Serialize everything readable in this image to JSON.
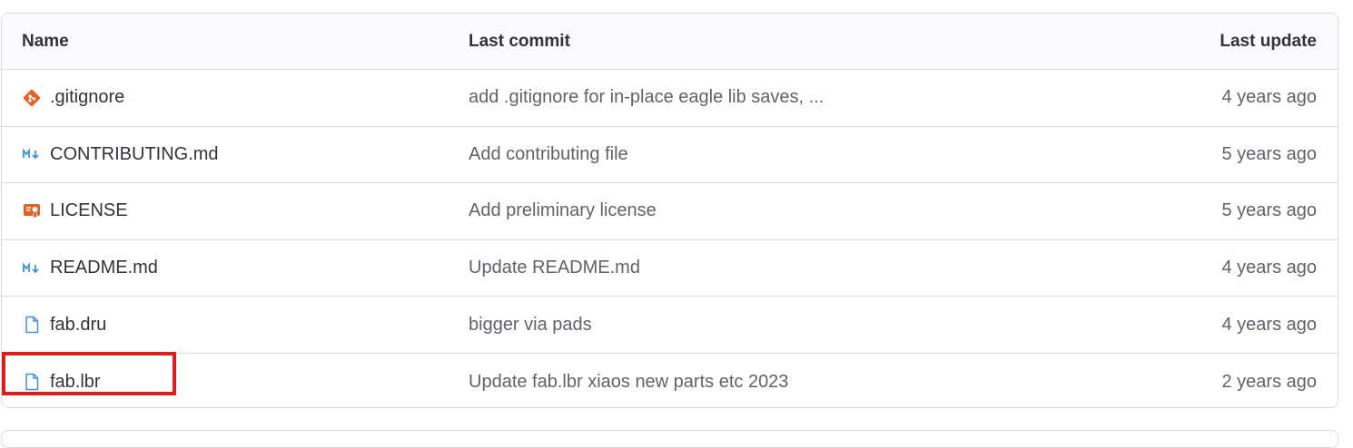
{
  "table": {
    "headers": {
      "name": "Name",
      "commit": "Last commit",
      "update": "Last update"
    },
    "rows": [
      {
        "name": ".gitignore",
        "icon": "git-icon",
        "commit": "add .gitignore for in-place eagle lib saves, ...",
        "date": "4 years ago"
      },
      {
        "name": "CONTRIBUTING.md",
        "icon": "markdown-icon",
        "commit": "Add contributing file",
        "date": "5 years ago"
      },
      {
        "name": "LICENSE",
        "icon": "license-icon",
        "commit": "Add preliminary license",
        "date": "5 years ago"
      },
      {
        "name": "README.md",
        "icon": "markdown-icon",
        "commit": "Update README.md",
        "date": "4 years ago"
      },
      {
        "name": "fab.dru",
        "icon": "file-icon",
        "commit": "bigger via pads",
        "date": "4 years ago"
      },
      {
        "name": "fab.lbr",
        "icon": "file-icon",
        "commit": "Update fab.lbr xiaos new parts etc 2023",
        "date": "2 years ago"
      }
    ]
  },
  "colors": {
    "git": "#e24329",
    "markdown": "#428fdc",
    "license": "#e2632a",
    "file": "#428fdc",
    "highlight": "#db1f1f"
  }
}
